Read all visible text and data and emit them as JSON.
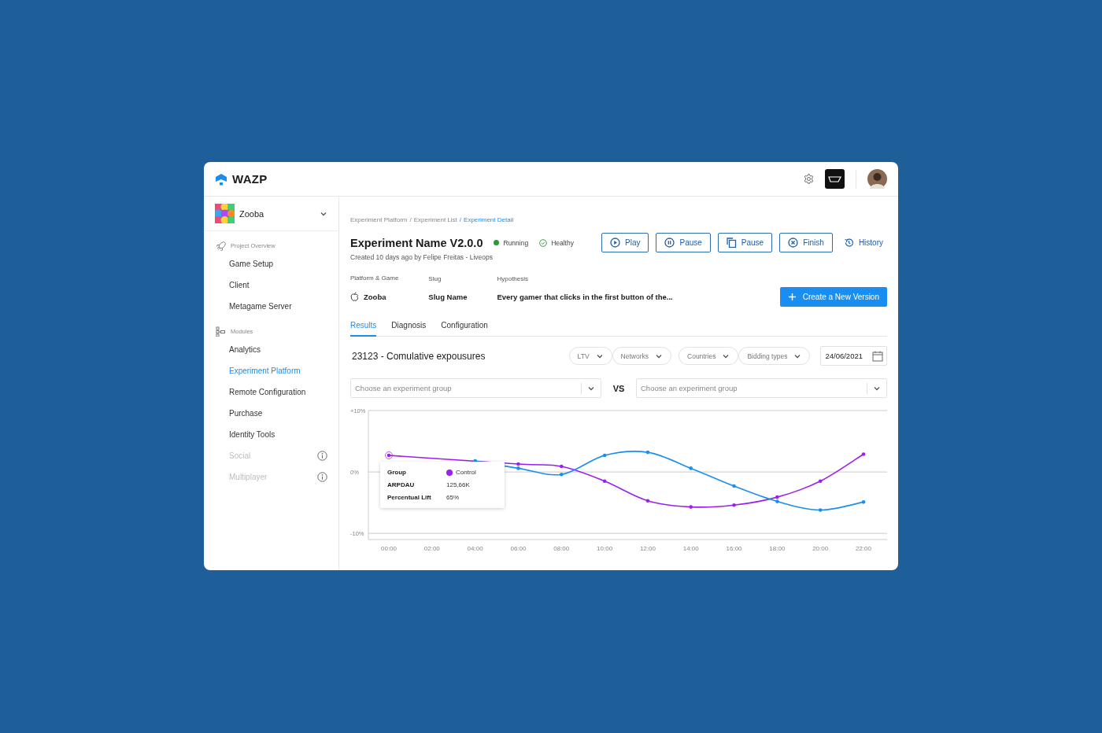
{
  "header": {
    "logo": "WAZP"
  },
  "sidebar": {
    "project": {
      "name": "Zooba"
    },
    "sections": [
      {
        "title": "Project Overview",
        "kind": "overview",
        "items": [
          {
            "label": "Game Setup",
            "selected": false,
            "disabled": false
          },
          {
            "label": "Client",
            "selected": false,
            "disabled": false
          },
          {
            "label": "Metagame Server",
            "selected": false,
            "disabled": false
          }
        ]
      },
      {
        "title": "Modules",
        "kind": "modules",
        "items": [
          {
            "label": "Analytics",
            "selected": false,
            "disabled": false
          },
          {
            "label": "Experiment Platform",
            "selected": true,
            "disabled": false
          },
          {
            "label": "Remote Configuration",
            "selected": false,
            "disabled": false
          },
          {
            "label": "Purchase",
            "selected": false,
            "disabled": false
          },
          {
            "label": "Identity Tools",
            "selected": false,
            "disabled": false
          },
          {
            "label": "Social",
            "selected": false,
            "disabled": true
          },
          {
            "label": "Multiplayer",
            "selected": false,
            "disabled": true
          }
        ]
      }
    ]
  },
  "breadcrumb": {
    "separator": "/",
    "items": [
      {
        "label": "Experiment Platform",
        "current": false
      },
      {
        "label": "Experiment List",
        "current": false
      },
      {
        "label": "Experiment Detail",
        "current": true
      }
    ]
  },
  "experiment": {
    "title": "Experiment Name V2.0.0",
    "subtitle": "Created 10 days ago by Felipe Freitas - Liveops",
    "statuses": [
      {
        "label": "Running",
        "kind": "dot"
      },
      {
        "label": "Healthy",
        "kind": "check"
      }
    ],
    "actions": [
      {
        "label": "Play",
        "kind": "play"
      },
      {
        "label": "Pause",
        "kind": "pause"
      },
      {
        "label": "Pause",
        "kind": "copy"
      },
      {
        "label": "Finish",
        "kind": "finish"
      },
      {
        "label": "History",
        "kind": "history"
      }
    ],
    "meta": [
      {
        "label": "Platform & Game",
        "value": "Zooba",
        "kind": "apple"
      },
      {
        "label": "Slug",
        "value": "Slug Name",
        "kind": "text"
      },
      {
        "label": "Hypothesis",
        "value": "Every gamer that clicks in the first button of the...",
        "kind": "text"
      }
    ],
    "primary_button": "Create a New Version"
  },
  "tabs": [
    {
      "label": "Results",
      "selected": true
    },
    {
      "label": "Diagnosis",
      "selected": false
    },
    {
      "label": "Configuration",
      "selected": false
    }
  ],
  "results": {
    "title": "23123 - Comulative expousures",
    "filters": [
      "LTV",
      "Networks",
      "Countries",
      "Bidding types"
    ],
    "date": "24/06/2021",
    "compare": {
      "left_placeholder": "Choose an experiment group",
      "vs": "VS",
      "right_placeholder": "Choose an experiment group"
    },
    "chart_data": {
      "type": "line",
      "categories": [
        "00:00",
        "02:00",
        "04:00",
        "06:00",
        "08:00",
        "10:00",
        "12:00",
        "14:00",
        "16:00",
        "18:00",
        "20:00",
        "22:00"
      ],
      "ylim": [
        -11,
        10
      ],
      "yticks": [
        {
          "value": 10,
          "label": "+10%"
        },
        {
          "value": 0,
          "label": "0%"
        },
        {
          "value": -10,
          "label": "-10%"
        }
      ],
      "series": [
        {
          "color": "#9b1ff0",
          "values": [
            2.7,
            null,
            null,
            1.3,
            0.9,
            -1.5,
            -4.7,
            -5.7,
            -5.4,
            -4.1,
            -1.5,
            2.9
          ]
        },
        {
          "color": "#1a8ef0",
          "values": [
            null,
            null,
            1.8,
            0.6,
            -0.4,
            2.7,
            3.2,
            0.6,
            -2.3,
            -4.8,
            -6.2,
            -4.9
          ]
        }
      ]
    },
    "tooltip": {
      "rows": [
        {
          "label": "Group",
          "value": "Control",
          "kind": "series"
        },
        {
          "label": "ARPDAU",
          "value": "125,66K",
          "kind": "text"
        },
        {
          "label": "Percentual Lift",
          "value": "65%",
          "kind": "text"
        }
      ]
    }
  }
}
